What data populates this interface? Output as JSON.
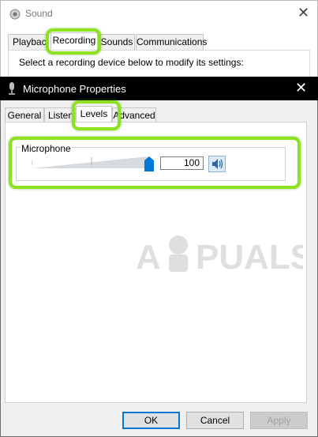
{
  "sound_window": {
    "title": "Sound",
    "tabs": [
      "Playback",
      "Recording",
      "Sounds",
      "Communications"
    ],
    "active_tab": "Recording",
    "instruction": "Select a recording device below to modify its settings:"
  },
  "mic_dialog": {
    "title": "Microphone Properties",
    "tabs": [
      "General",
      "Listen",
      "Levels",
      "Advanced"
    ],
    "active_tab": "Levels",
    "group_label": "Microphone",
    "level_value": "100",
    "slider_level_percent": 100,
    "buttons": {
      "ok": "OK",
      "cancel": "Cancel",
      "apply": "Apply"
    }
  },
  "watermark_text": "APPUALS",
  "colors": {
    "highlight": "#8ce21f",
    "accent": "#0078d7",
    "titlebar": "#000000"
  }
}
